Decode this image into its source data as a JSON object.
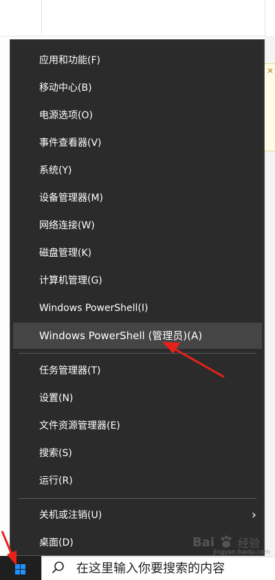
{
  "menu": {
    "items": [
      {
        "label": "应用和功能(F)"
      },
      {
        "label": "移动中心(B)"
      },
      {
        "label": "电源选项(O)"
      },
      {
        "label": "事件查看器(V)"
      },
      {
        "label": "系统(Y)"
      },
      {
        "label": "设备管理器(M)"
      },
      {
        "label": "网络连接(W)"
      },
      {
        "label": "磁盘管理(K)"
      },
      {
        "label": "计算机管理(G)"
      },
      {
        "label": "Windows PowerShell(I)"
      },
      {
        "label": "Windows PowerShell (管理员)(A)",
        "highlighted": true
      },
      {
        "label": "任务管理器(T)"
      },
      {
        "label": "设置(N)"
      },
      {
        "label": "文件资源管理器(E)"
      },
      {
        "label": "搜索(S)"
      },
      {
        "label": "运行(R)"
      },
      {
        "label": "关机或注销(U)",
        "has_submenu": true
      },
      {
        "label": "桌面(D)"
      }
    ]
  },
  "taskbar": {
    "search_placeholder": "在这里输入你要搜索的内容"
  },
  "watermark": {
    "text": "Bai",
    "sub": "经验",
    "url": "jingyan.baidu.com"
  },
  "colors": {
    "menu_bg": "#2b2b2b",
    "highlight_bg": "#454545",
    "arrow_red": "#e8221b",
    "start_blue": "#1e90ff"
  }
}
